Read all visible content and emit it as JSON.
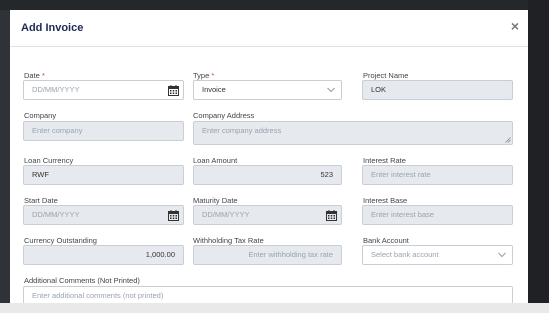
{
  "modal": {
    "title": "Add Invoice",
    "close_glyph": "×"
  },
  "form": {
    "date": {
      "label": "Date",
      "required_mark": "*",
      "placeholder": "DD/MM/YYYY",
      "icon": "calendar-icon"
    },
    "type": {
      "label": "Type",
      "required_mark": "*",
      "value": "Invoice",
      "icon": "chevron-down-icon"
    },
    "project_name": {
      "label": "Project Name",
      "value": "LOK"
    },
    "company": {
      "label": "Company",
      "placeholder": "Enter company"
    },
    "company_address": {
      "label": "Company Address",
      "placeholder": "Enter company address"
    },
    "loan_currency": {
      "label": "Loan Currency",
      "value": "RWF"
    },
    "loan_amount": {
      "label": "Loan Amount",
      "value": "523"
    },
    "interest_rate": {
      "label": "Interest Rate",
      "placeholder": "Enter interest rate"
    },
    "start_date": {
      "label": "Start Date",
      "placeholder": "DD/MM/YYYY",
      "icon": "calendar-icon"
    },
    "maturity_date": {
      "label": "Maturity Date",
      "placeholder": "DD/MM/YYYY",
      "icon": "calendar-icon"
    },
    "interest_base": {
      "label": "Interest Base",
      "placeholder": "Enter interest base"
    },
    "currency_outstanding": {
      "label": "Currency Outstanding",
      "value": "1,000.00"
    },
    "withholding_tax_rate": {
      "label": "Withholding Tax Rate",
      "placeholder": "Enter withholding tax rate"
    },
    "bank_account": {
      "label": "Bank Account",
      "placeholder": "Select bank account",
      "icon": "chevron-down-icon"
    },
    "additional_comments": {
      "label": "Additional Comments (Not Printed)",
      "placeholder": "Enter additional comments (not printed)"
    }
  },
  "colors": {
    "title": "#1d2a55",
    "required": "#e23b3b",
    "readonly_field_bg": "#e6e9ed",
    "field_border": "#c9ced6"
  }
}
